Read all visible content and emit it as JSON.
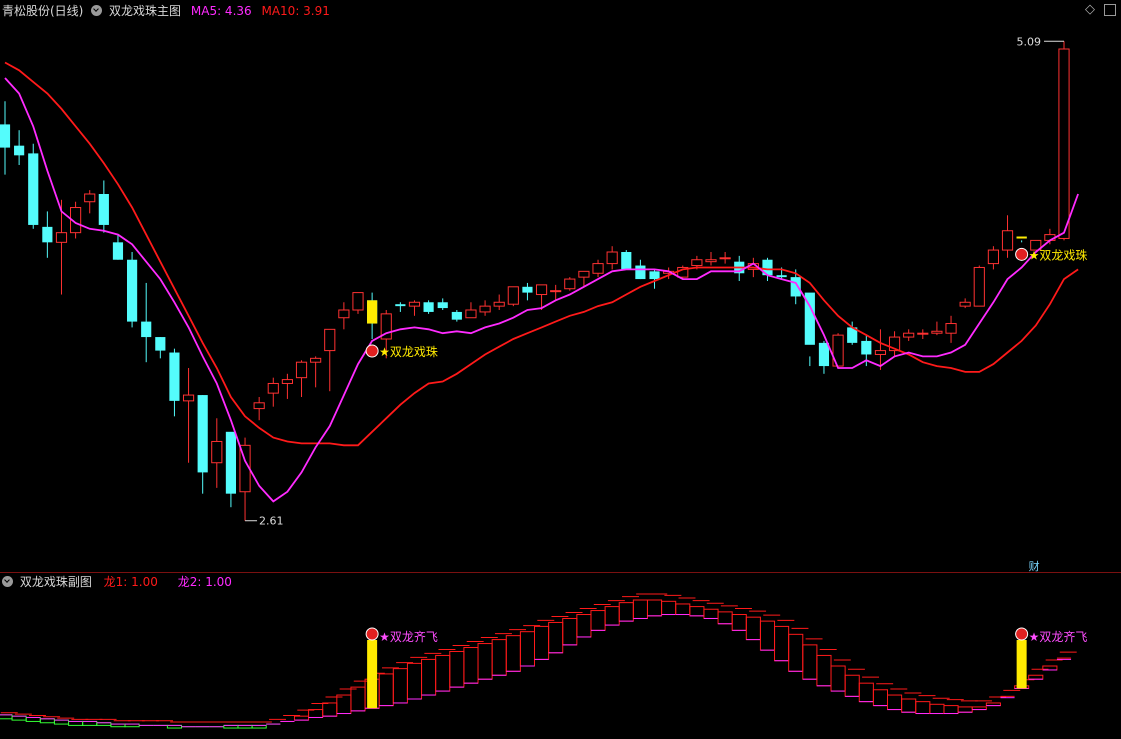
{
  "header": {
    "stock": "青松股份(日线)",
    "main_title": "双龙戏珠主图",
    "ma5_label": "MA5: 4.36",
    "ma10_label": "MA10: 3.91",
    "ma5_color": "#ff2bff",
    "ma10_color": "#ff1a1a"
  },
  "sub_header": {
    "title": "双龙戏珠副图",
    "long1_label": "龙1: 1.00",
    "long2_label": "龙2: 1.00",
    "long1_color": "#ff1a1a",
    "long2_color": "#ff2bff"
  },
  "annotations": {
    "max_label": "5.09",
    "min_label": "2.61",
    "signal_label": "★双龙戏珠",
    "sub_signal_label": "★双龙齐飞",
    "cai_label": "财"
  },
  "chart_data": [
    {
      "type": "candlestick",
      "title": "双龙戏珠主图",
      "ylim": [
        2.5,
        5.2
      ],
      "max_price": 5.09,
      "min_price": 2.61,
      "up_color": "#ff3232",
      "down_color": "#54fcfc",
      "candles": [
        [
          4.66,
          4.78,
          4.4,
          4.54
        ],
        [
          4.55,
          4.63,
          4.45,
          4.5
        ],
        [
          4.51,
          4.56,
          4.12,
          4.14
        ],
        [
          4.13,
          4.21,
          3.97,
          4.05
        ],
        [
          4.05,
          4.27,
          3.78,
          4.1
        ],
        [
          4.1,
          4.26,
          4.07,
          4.23
        ],
        [
          4.26,
          4.32,
          4.2,
          4.3
        ],
        [
          4.3,
          4.37,
          4.1,
          4.14
        ],
        [
          4.05,
          4.09,
          3.96,
          3.96
        ],
        [
          3.96,
          4.0,
          3.61,
          3.64
        ],
        [
          3.64,
          3.84,
          3.43,
          3.56
        ],
        [
          3.56,
          3.56,
          3.45,
          3.49
        ],
        [
          3.48,
          3.5,
          3.15,
          3.23
        ],
        [
          3.23,
          3.4,
          2.91,
          3.26
        ],
        [
          3.26,
          3.26,
          2.75,
          2.86
        ],
        [
          2.91,
          3.14,
          2.78,
          3.02
        ],
        [
          3.07,
          2.9,
          2.68,
          2.75
        ],
        [
          2.76,
          3.04,
          2.61,
          3.0
        ],
        [
          3.19,
          3.25,
          3.13,
          3.22
        ],
        [
          3.27,
          3.35,
          3.2,
          3.32
        ],
        [
          3.32,
          3.37,
          3.24,
          3.34
        ],
        [
          3.35,
          3.44,
          3.25,
          3.43
        ],
        [
          3.43,
          3.46,
          3.3,
          3.45
        ],
        [
          3.49,
          3.6,
          3.28,
          3.6
        ],
        [
          3.66,
          3.74,
          3.6,
          3.7
        ],
        [
          3.7,
          3.79,
          3.68,
          3.79
        ],
        [
          3.75,
          3.79,
          3.55,
          3.63
        ],
        [
          3.55,
          3.7,
          3.45,
          3.68
        ],
        [
          3.73,
          3.74,
          3.69,
          3.72
        ],
        [
          3.72,
          3.75,
          3.67,
          3.74
        ],
        [
          3.74,
          3.75,
          3.68,
          3.69
        ],
        [
          3.74,
          3.76,
          3.7,
          3.71
        ],
        [
          3.69,
          3.7,
          3.64,
          3.65
        ],
        [
          3.66,
          3.74,
          3.66,
          3.7
        ],
        [
          3.69,
          3.75,
          3.67,
          3.72
        ],
        [
          3.72,
          3.78,
          3.7,
          3.74
        ],
        [
          3.73,
          3.82,
          3.72,
          3.82
        ],
        [
          3.82,
          3.84,
          3.75,
          3.79
        ],
        [
          3.78,
          3.83,
          3.7,
          3.83
        ],
        [
          3.8,
          3.83,
          3.75,
          3.8
        ],
        [
          3.81,
          3.87,
          3.8,
          3.86
        ],
        [
          3.87,
          3.9,
          3.82,
          3.9
        ],
        [
          3.89,
          3.96,
          3.87,
          3.94
        ],
        [
          3.94,
          4.03,
          3.91,
          4.0
        ],
        [
          4.0,
          4.01,
          3.91,
          3.91
        ],
        [
          3.93,
          3.96,
          3.86,
          3.86
        ],
        [
          3.9,
          3.91,
          3.81,
          3.86
        ],
        [
          3.89,
          3.92,
          3.86,
          3.9
        ],
        [
          3.87,
          3.93,
          3.86,
          3.92
        ],
        [
          3.93,
          3.98,
          3.91,
          3.96
        ],
        [
          3.95,
          4.0,
          3.93,
          3.96
        ],
        [
          3.97,
          4.0,
          3.94,
          3.97
        ],
        [
          3.95,
          3.98,
          3.85,
          3.89
        ],
        [
          3.91,
          3.97,
          3.87,
          3.94
        ],
        [
          3.96,
          3.97,
          3.85,
          3.88
        ],
        [
          3.88,
          3.92,
          3.86,
          3.87
        ],
        [
          3.87,
          3.91,
          3.73,
          3.77
        ],
        [
          3.79,
          3.46,
          3.41,
          3.52
        ],
        [
          3.53,
          3.54,
          3.37,
          3.41
        ],
        [
          3.41,
          3.58,
          3.43,
          3.57
        ],
        [
          3.61,
          3.64,
          3.52,
          3.53
        ],
        [
          3.54,
          3.57,
          3.41,
          3.47
        ],
        [
          3.47,
          3.6,
          3.39,
          3.49
        ],
        [
          3.49,
          3.59,
          3.46,
          3.56
        ],
        [
          3.56,
          3.6,
          3.54,
          3.58
        ],
        [
          3.58,
          3.6,
          3.55,
          3.58
        ],
        [
          3.58,
          3.64,
          3.57,
          3.59
        ],
        [
          3.58,
          3.67,
          3.53,
          3.63
        ],
        [
          3.72,
          3.76,
          3.71,
          3.74
        ],
        [
          3.72,
          3.93,
          3.8,
          3.92
        ],
        [
          3.94,
          4.03,
          3.91,
          4.01
        ],
        [
          4.01,
          4.19,
          3.97,
          4.11
        ],
        [
          4.08,
          4.06,
          4.05,
          4.07
        ],
        [
          4.01,
          4.06,
          4.04,
          4.06
        ],
        [
          4.06,
          4.12,
          4.04,
          4.09
        ],
        [
          4.07,
          5.09,
          4.06,
          5.05
        ]
      ],
      "ma5": [
        4.9,
        4.82,
        4.65,
        4.42,
        4.21,
        4.15,
        4.12,
        4.11,
        4.09,
        4.04,
        3.95,
        3.86,
        3.74,
        3.61,
        3.46,
        3.32,
        3.13,
        2.92,
        2.79,
        2.71,
        2.76,
        2.86,
        2.99,
        3.1,
        3.26,
        3.42,
        3.54,
        3.58,
        3.6,
        3.61,
        3.6,
        3.58,
        3.59,
        3.58,
        3.61,
        3.63,
        3.66,
        3.7,
        3.71,
        3.75,
        3.78,
        3.82,
        3.86,
        3.9,
        3.91,
        3.91,
        3.91,
        3.9,
        3.86,
        3.86,
        3.9,
        3.9,
        3.9,
        3.94,
        3.88,
        3.86,
        3.84,
        3.72,
        3.57,
        3.4,
        3.4,
        3.44,
        3.41,
        3.46,
        3.48,
        3.46,
        3.46,
        3.48,
        3.52,
        3.63,
        3.74,
        3.86,
        3.92,
        4.0,
        4.06,
        4.1,
        4.3
      ],
      "ma10": [
        4.98,
        4.94,
        4.88,
        4.82,
        4.74,
        4.65,
        4.56,
        4.46,
        4.35,
        4.23,
        4.09,
        3.95,
        3.81,
        3.67,
        3.53,
        3.4,
        3.25,
        3.15,
        3.09,
        3.04,
        3.02,
        3.01,
        3.01,
        3.01,
        3.0,
        3.0,
        3.07,
        3.14,
        3.21,
        3.27,
        3.32,
        3.33,
        3.37,
        3.42,
        3.47,
        3.51,
        3.55,
        3.58,
        3.61,
        3.64,
        3.67,
        3.69,
        3.72,
        3.74,
        3.78,
        3.82,
        3.85,
        3.88,
        3.91,
        3.92,
        3.92,
        3.92,
        3.92,
        3.92,
        3.91,
        3.91,
        3.89,
        3.84,
        3.75,
        3.67,
        3.61,
        3.57,
        3.53,
        3.5,
        3.47,
        3.43,
        3.41,
        3.4,
        3.38,
        3.38,
        3.42,
        3.48,
        3.54,
        3.62,
        3.73,
        3.86,
        3.91
      ]
    },
    {
      "type": "staircase",
      "title": "双龙戏珠副图",
      "series": [
        {
          "name": "龙1",
          "color": "#ff1a1a",
          "values": [
            0.1,
            0.09,
            0.08,
            0.07,
            0.06,
            0.05,
            0.05,
            0.05,
            0.04,
            0.04,
            0.04,
            0.04,
            0.03,
            0.03,
            0.03,
            0.03,
            0.03,
            0.03,
            0.03,
            0.05,
            0.08,
            0.12,
            0.17,
            0.22,
            0.28,
            0.34,
            0.4,
            0.44,
            0.48,
            0.52,
            0.55,
            0.58,
            0.61,
            0.64,
            0.67,
            0.7,
            0.73,
            0.76,
            0.8,
            0.83,
            0.86,
            0.89,
            0.92,
            0.95,
            0.98,
            1.0,
            1.0,
            0.99,
            0.97,
            0.95,
            0.93,
            0.91,
            0.89,
            0.87,
            0.84,
            0.8,
            0.74,
            0.66,
            0.58,
            0.5,
            0.43,
            0.37,
            0.32,
            0.28,
            0.25,
            0.23,
            0.21,
            0.2,
            0.19,
            0.19,
            0.22,
            0.27,
            0.35,
            0.43,
            0.5,
            0.56,
            0.62
          ]
        },
        {
          "name": "龙2",
          "color": "#ff2bff",
          "values": [
            0.13,
            0.12,
            0.11,
            0.1,
            0.09,
            0.08,
            0.08,
            0.07,
            0.06,
            0.06,
            0.05,
            0.05,
            0.05,
            0.04,
            0.04,
            0.04,
            0.05,
            0.05,
            0.05,
            0.06,
            0.08,
            0.09,
            0.11,
            0.12,
            0.14,
            0.16,
            0.18,
            0.2,
            0.22,
            0.25,
            0.28,
            0.31,
            0.34,
            0.37,
            0.4,
            0.43,
            0.46,
            0.5,
            0.55,
            0.6,
            0.66,
            0.72,
            0.77,
            0.81,
            0.84,
            0.86,
            0.88,
            0.89,
            0.89,
            0.88,
            0.86,
            0.82,
            0.77,
            0.7,
            0.62,
            0.54,
            0.46,
            0.4,
            0.35,
            0.31,
            0.27,
            0.23,
            0.2,
            0.17,
            0.15,
            0.14,
            0.14,
            0.14,
            0.15,
            0.17,
            0.2,
            0.26,
            0.33,
            0.4,
            0.47,
            0.55,
            0.62
          ]
        }
      ],
      "signals": [
        26,
        72
      ]
    }
  ]
}
